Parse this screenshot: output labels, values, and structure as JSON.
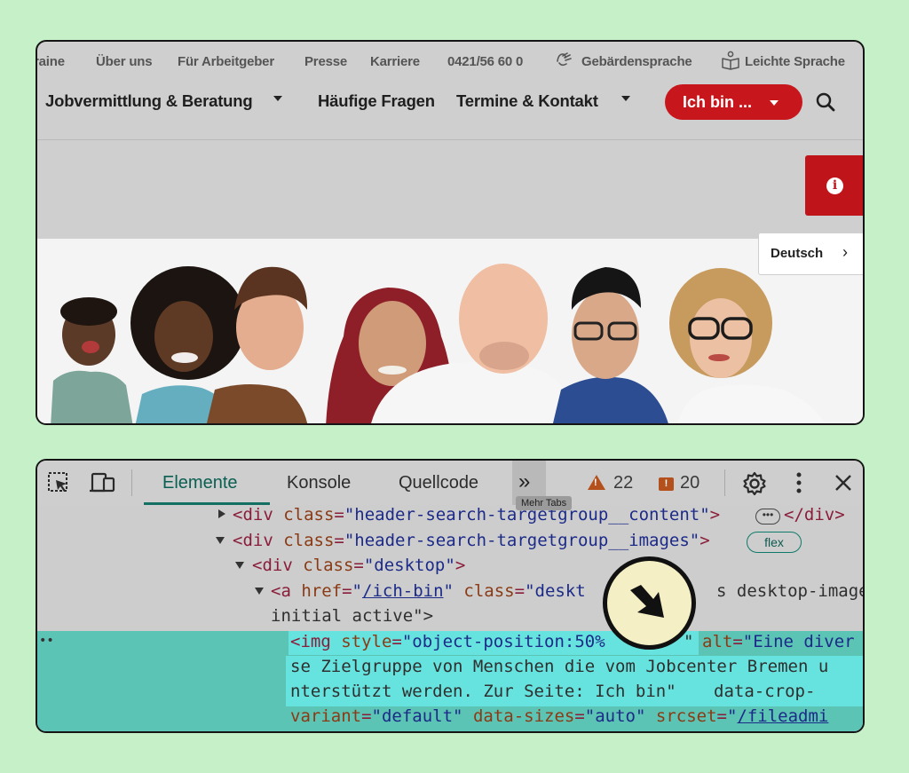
{
  "website": {
    "top_links": [
      "raine",
      "Über uns",
      "Für Arbeitgeber",
      "Presse",
      "Karriere",
      "0421/56 60 0",
      "Gebärdensprache",
      "Leichte Sprache"
    ],
    "main_nav": [
      {
        "label": "Jobvermittlung & Beratung",
        "has_dropdown": true
      },
      {
        "label": "Häufige Fragen",
        "has_dropdown": false
      },
      {
        "label": "Termine & Kontakt",
        "has_dropdown": true
      }
    ],
    "cta_button": "Ich bin ...",
    "language": "Deutsch",
    "accent_color": "#c7171d"
  },
  "devtools": {
    "tabs": [
      "Elemente",
      "Konsole",
      "Quellcode"
    ],
    "active_tab": "Elemente",
    "more_tabs_tooltip": "Mehr Tabs",
    "warnings": "22",
    "errors": "20",
    "code_lines": {
      "l1_tag_open": "<div ",
      "l1_attr": "class",
      "l1_eq": "=",
      "l1_val": "\"header-search-targetgroup__content\"",
      "l1_close": ">",
      "l1_end": "</div>",
      "l2_tag_open": "<div ",
      "l2_attr": "class",
      "l2_eq": "=",
      "l2_val": "\"header-search-targetgroup__images\"",
      "l2_close": ">",
      "l2_badge": "flex",
      "l3_tag_open": "<div ",
      "l3_attr": "class",
      "l3_eq": "=",
      "l3_val": "\"desktop\"",
      "l3_close": ">",
      "l4_tag_open": "<a ",
      "l4_attr1": "href",
      "l4_eq": "=",
      "l4_q1": "\"",
      "l4_link": "/ich-bin",
      "l4_q2": "\"",
      "l4_attr2": " class",
      "l4_eq2": "=",
      "l4_val2a": "\"deskt",
      "l4_val2b": "s desktop-image-",
      "l5": "initial active\">",
      "l6_tag_open": "<img ",
      "l6_attr": "style",
      "l6_eq": "=",
      "l6_val": "\"object-position:50%",
      "l6_val_tail": "\"",
      "l6_attr2": "alt",
      "l6_eq2": "=",
      "l6_alt_start": "\"Eine diver",
      "l7": "se Zielgruppe von Menschen die vom Jobcenter Bremen u",
      "l8": "nterstützt werden. Zur Seite: Ich bin\"",
      "l8_attr": "data-crop-",
      "l9_attr": "variant",
      "l9_eq": "=",
      "l9_val": "\"default\"",
      "l9_attr2": "data-sizes",
      "l9_eq2": "=",
      "l9_val2": "\"auto\"",
      "l9_attr3": "srcset",
      "l9_eq3": "=",
      "l9_q": "\"",
      "l9_link": "/fileadmi"
    }
  }
}
